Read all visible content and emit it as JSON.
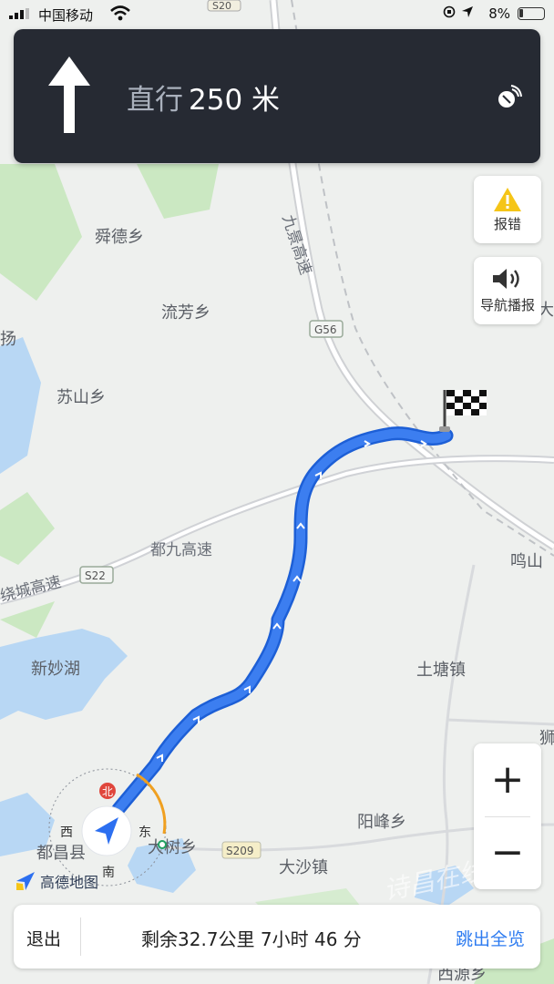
{
  "status_bar": {
    "carrier": "中国移动",
    "battery": "8%"
  },
  "nav": {
    "instruction": "直行",
    "distance": "250 米"
  },
  "side_buttons": {
    "report_label": "报错",
    "voice_label": "导航播报"
  },
  "zoom": {
    "in_label": "+",
    "out_label": "−"
  },
  "map": {
    "labels": {
      "shunde": "舜德乡",
      "liufang": "流芳乡",
      "sushan": "苏山乡",
      "duchang_highway": "都九高速",
      "ring_highway": "绕城高速",
      "xinmiao_lake": "新妙湖",
      "tutang": "土塘镇",
      "yangfeng": "阳峰乡",
      "dashu": "大树乡",
      "dasha": "大沙镇",
      "duchang_county": "都昌县",
      "mingshan": "鸣山",
      "xiyuan": "西源乡",
      "jiujing": "九景高速",
      "s20": "S20",
      "g56": "G56",
      "s22": "S22",
      "s209": "S209",
      "yang": "扬",
      "da": "大",
      "shi": "狮"
    },
    "compass": {
      "north": "北",
      "east": "东",
      "south": "南",
      "west": "西"
    },
    "colors": {
      "route": "#3c7ef0",
      "land": "#eef0ee",
      "water": "#b8d7f4",
      "green": "#cbe8c2"
    }
  },
  "logo": {
    "text": "高德地图"
  },
  "bottom_bar": {
    "exit_label": "退出",
    "remaining": "剩余32.7公里 7小时 46 分",
    "overview_label": "跳出全览"
  },
  "watermark": "诗昌在线"
}
